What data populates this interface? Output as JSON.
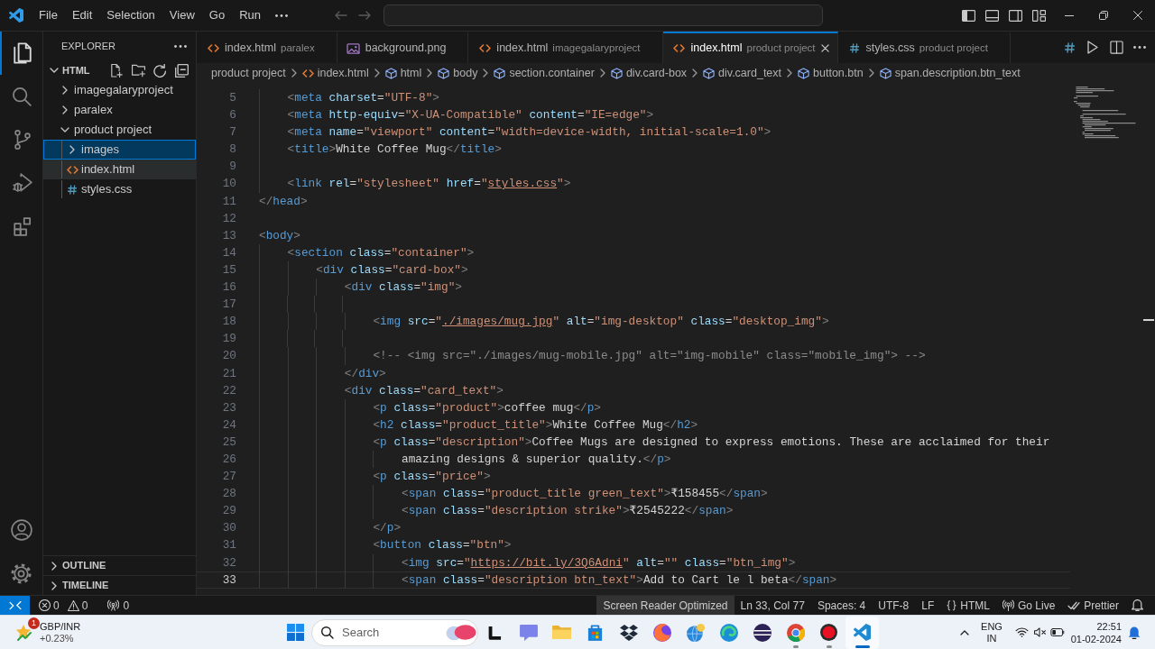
{
  "title_bar": {
    "menu": [
      "File",
      "Edit",
      "Selection",
      "View",
      "Go",
      "Run"
    ]
  },
  "activity_bar": {
    "top": [
      {
        "kind": "explorer",
        "selected": true
      },
      {
        "kind": "search",
        "selected": false
      },
      {
        "kind": "source_control",
        "selected": false
      },
      {
        "kind": "run_debug",
        "selected": false
      },
      {
        "kind": "extensions",
        "selected": false
      }
    ],
    "bottom": [
      {
        "kind": "accounts"
      },
      {
        "kind": "settings"
      }
    ]
  },
  "sidebar": {
    "title": "EXPLORER",
    "section": {
      "title": "HTML",
      "expanded": true,
      "tree": [
        {
          "label": "imagegalaryproject",
          "kind": "folder",
          "expanded": false,
          "selected": false,
          "active": false
        },
        {
          "label": "paralex",
          "kind": "folder",
          "expanded": false,
          "selected": false,
          "active": false
        },
        {
          "label": "product project",
          "kind": "folder",
          "expanded": true,
          "selected": false,
          "active": false,
          "children": [
            {
              "label": "images",
              "kind": "folder",
              "expanded": false,
              "selected": true,
              "active": false
            },
            {
              "label": "index.html",
              "kind": "html",
              "selected": false,
              "active": true
            },
            {
              "label": "styles.css",
              "kind": "css",
              "selected": false,
              "active": false
            }
          ]
        }
      ]
    },
    "panels": [
      {
        "title": "OUTLINE",
        "expanded": false
      },
      {
        "title": "TIMELINE",
        "expanded": false
      }
    ]
  },
  "tabs": [
    {
      "label": "index.html",
      "description": "paralex",
      "kind": "html",
      "selected": false
    },
    {
      "label": "background.png",
      "kind": "image",
      "selected": false
    },
    {
      "label": "index.html",
      "description": "imagegalaryproject",
      "kind": "html",
      "selected": false
    },
    {
      "label": "index.html",
      "description": "product project",
      "kind": "html",
      "selected": true
    },
    {
      "label": "styles.css",
      "description": "product project",
      "kind": "css",
      "selected": false
    }
  ],
  "breadcrumb": [
    {
      "label": "product project",
      "kind": "folder"
    },
    {
      "label": "index.html",
      "kind": "html"
    },
    {
      "label": "html",
      "kind": "element"
    },
    {
      "label": "body",
      "kind": "element"
    },
    {
      "label": "section.container",
      "kind": "element"
    },
    {
      "label": "div.card-box",
      "kind": "element"
    },
    {
      "label": "div.card_text",
      "kind": "element"
    },
    {
      "label": "button.btn",
      "kind": "element"
    },
    {
      "label": "span.description.btn_text",
      "kind": "element"
    }
  ],
  "editor": {
    "lines": [
      {
        "number": "5",
        "current": false,
        "text": "    <meta charset=\"UTF-8\">"
      },
      {
        "number": "6",
        "current": false,
        "text": "    <meta http-equiv=\"X-UA-Compatible\" content=\"IE=edge\">"
      },
      {
        "number": "7",
        "current": false,
        "text": "    <meta name=\"viewport\" content=\"width=device-width, initial-scale=1.0\">"
      },
      {
        "number": "8",
        "current": false,
        "text": "    <title>White Coffee Mug</title>"
      },
      {
        "number": "9",
        "current": false
      },
      {
        "number": "10",
        "current": false,
        "text": [
          "    <link rel=\"stylesheet\" href=\"",
          {
            "link": "styles.css"
          },
          "\">"
        ]
      },
      {
        "number": "11",
        "current": false,
        "text": "</head>"
      },
      {
        "number": "12",
        "current": false
      },
      {
        "number": "13",
        "current": false,
        "text": "<body>"
      },
      {
        "number": "14",
        "current": false,
        "text": "    <section class=\"container\">"
      },
      {
        "number": "15",
        "current": false,
        "text": "        <div class=\"card-box\">"
      },
      {
        "number": "16",
        "current": false,
        "text": "            <div class=\"img\">"
      },
      {
        "number": "17",
        "current": false
      },
      {
        "number": "18",
        "current": false,
        "text": [
          "                <img src=\"",
          {
            "link": "./images/mug.jpg"
          },
          "\" alt=\"img-desktop\" class=\"desktop_img\">"
        ]
      },
      {
        "number": "19",
        "current": false
      },
      {
        "number": "20",
        "current": false,
        "text": "                <!-- <img src=\"./images/mug-mobile.jpg\" alt=\"img-mobile\" class=\"mobile_img\"> -->"
      },
      {
        "number": "21",
        "current": false,
        "text": "            </div>"
      },
      {
        "number": "22",
        "current": false,
        "text": "            <div class=\"card_text\">"
      },
      {
        "number": "23",
        "current": false,
        "text": "                <p class=\"product\">coffee mug</p>"
      },
      {
        "number": "24",
        "current": false,
        "text": "                <h2 class=\"product_title\">White Coffee Mug</h2>"
      },
      {
        "number": "25",
        "current": false,
        "text": "                <p class=\"description\">Coffee Mugs are designed to express emotions. These are acclaimed for their"
      },
      {
        "number": "26",
        "current": false,
        "text": "                    amazing designs & superior quality.</p>"
      },
      {
        "number": "27",
        "current": false,
        "text": "                <p class=\"price\">"
      },
      {
        "number": "28",
        "current": false,
        "text": "                    <span class=\"product_title green_text\">₹158455</span>"
      },
      {
        "number": "29",
        "current": false,
        "text": "                    <span class=\"description strike\">₹2545222</span>"
      },
      {
        "number": "30",
        "current": false,
        "text": "                </p>"
      },
      {
        "number": "31",
        "current": false,
        "text": "                <button class=\"btn\">"
      },
      {
        "number": "32",
        "current": false,
        "text": [
          "                    <img src=\"",
          {
            "link": "https://bit.ly/3Q6Adni"
          },
          "\" alt=\"\" class=\"btn_img\">"
        ]
      },
      {
        "number": "33",
        "current": true,
        "text": "                    <span class=\"description btn_text\">Add to Cart le l beta</span>"
      }
    ]
  },
  "status_bar": {
    "problems": {
      "errors": "0",
      "warnings": "0"
    },
    "ports": {
      "count": "0"
    },
    "items": [
      {
        "kind": "plain",
        "label": "Screen Reader Optimized",
        "highlighted": true
      },
      {
        "kind": "plain",
        "label": "Ln 33, Col 77",
        "highlighted": false
      },
      {
        "kind": "plain",
        "label": "Spaces: 4",
        "highlighted": false
      },
      {
        "kind": "plain",
        "label": "UTF-8",
        "highlighted": false
      },
      {
        "kind": "plain",
        "label": "LF",
        "highlighted": false
      },
      {
        "kind": "language",
        "label": "HTML",
        "highlighted": false
      },
      {
        "kind": "live",
        "label": "Go Live",
        "highlighted": false
      },
      {
        "kind": "prettier",
        "label": "Prettier",
        "highlighted": false
      },
      {
        "kind": "bell",
        "highlighted": false
      }
    ]
  },
  "taskbar": {
    "widget": {
      "badge": "1",
      "title": "GBP/INR",
      "change": "+0.23%"
    },
    "search": {
      "placeholder": "Search"
    },
    "apps": [
      {
        "kind": "terminal",
        "running": false,
        "selected": false
      },
      {
        "kind": "chat",
        "running": false,
        "selected": false
      },
      {
        "kind": "folder",
        "running": false,
        "selected": false
      },
      {
        "kind": "store",
        "running": false,
        "selected": false
      },
      {
        "kind": "box",
        "running": false,
        "selected": false
      },
      {
        "kind": "fox",
        "running": false,
        "selected": false
      },
      {
        "kind": "globe",
        "running": false,
        "selected": false
      },
      {
        "kind": "wave",
        "running": false,
        "selected": false
      },
      {
        "kind": "sphere",
        "running": false,
        "selected": false
      },
      {
        "kind": "wheel",
        "running": true,
        "selected": false
      },
      {
        "kind": "record",
        "running": true,
        "selected": false
      },
      {
        "kind": "editor",
        "running": true,
        "selected": true
      }
    ],
    "tray": {
      "language": "ENG",
      "region": "IN",
      "time": "22:51",
      "date": "01-02-2024"
    }
  }
}
